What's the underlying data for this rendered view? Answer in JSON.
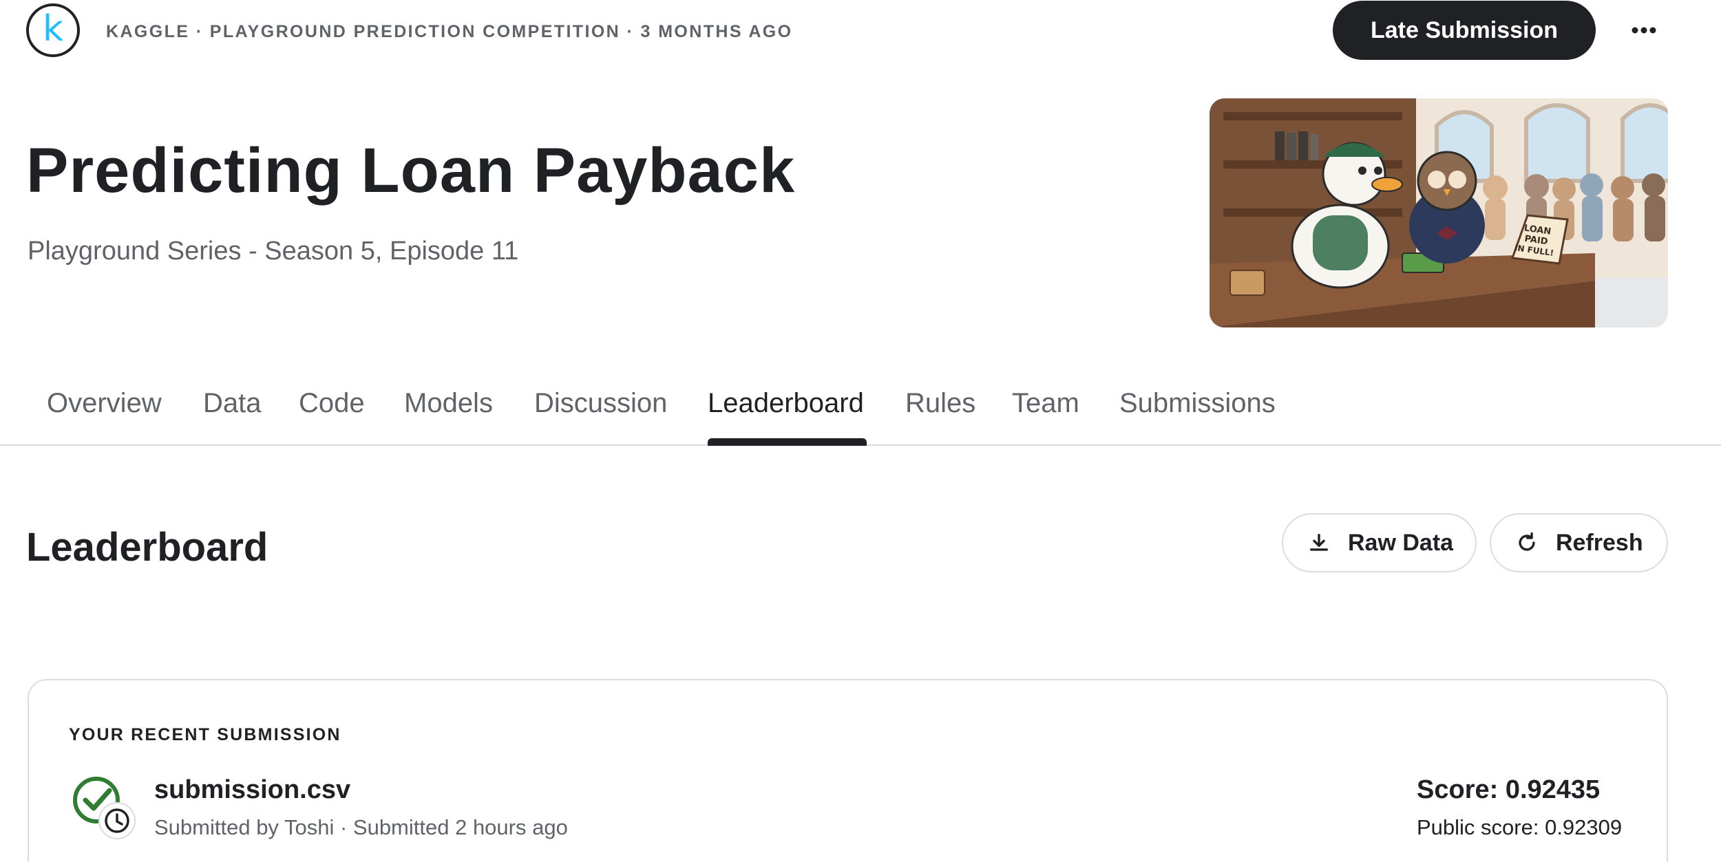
{
  "header": {
    "meta": "KAGGLE · PLAYGROUND PREDICTION COMPETITION · 3 MONTHS AGO",
    "late_submission_label": "Late Submission",
    "brand_color": "#20beff"
  },
  "competition": {
    "title": "Predicting Loan Payback",
    "subtitle": "Playground Series - Season 5, Episode 11",
    "banner_sign": [
      "LOAN",
      "PAID",
      "IN FULL!"
    ]
  },
  "tabs": [
    {
      "label": "Overview"
    },
    {
      "label": "Data"
    },
    {
      "label": "Code"
    },
    {
      "label": "Models"
    },
    {
      "label": "Discussion"
    },
    {
      "label": "Leaderboard",
      "active": true
    },
    {
      "label": "Rules"
    },
    {
      "label": "Team"
    },
    {
      "label": "Submissions"
    }
  ],
  "leaderboard": {
    "title": "Leaderboard",
    "raw_data_label": "Raw Data",
    "refresh_label": "Refresh"
  },
  "recent_submission": {
    "section_label": "YOUR RECENT SUBMISSION",
    "file_name": "submission.csv",
    "submitted_by": "Submitted by Toshi · Submitted 2 hours ago",
    "score": "Score: 0.92435",
    "public_score": "Public score: 0.92309",
    "status_color": "#2e7d32"
  }
}
